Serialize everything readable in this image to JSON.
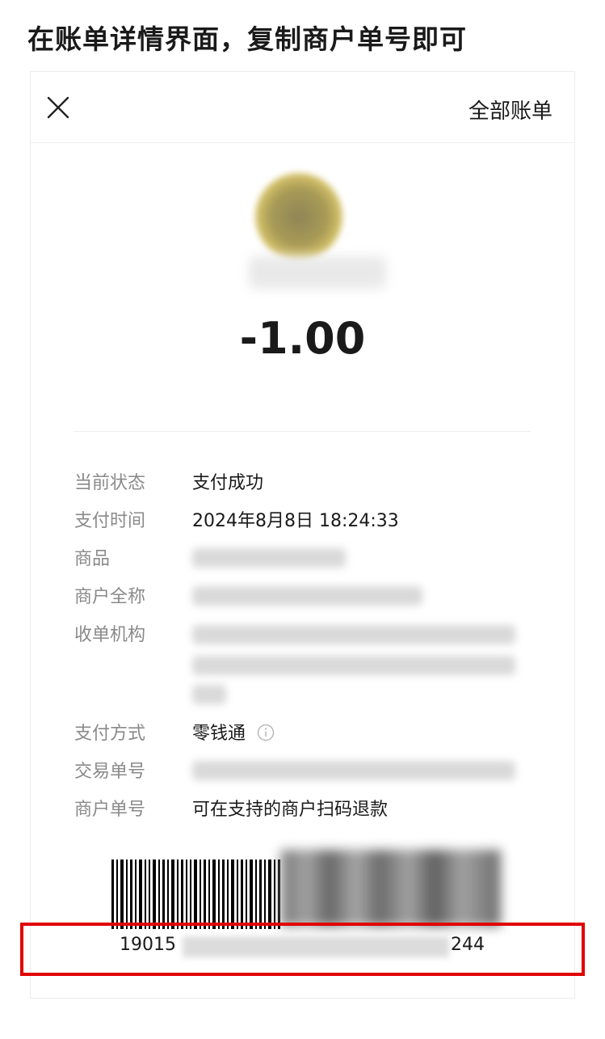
{
  "instruction": "在账单详情界面，复制商户单号即可",
  "header": {
    "all_bills_label": "全部账单"
  },
  "summary": {
    "amount": "-1.00"
  },
  "details": {
    "status": {
      "label": "当前状态",
      "value": "支付成功"
    },
    "pay_time": {
      "label": "支付时间",
      "value": "2024年8月8日 18:24:33"
    },
    "product": {
      "label": "商品"
    },
    "merchant_full_name": {
      "label": "商户全称"
    },
    "acquirer": {
      "label": "收单机构"
    },
    "pay_method": {
      "label": "支付方式",
      "value": "零钱通"
    },
    "transaction_no": {
      "label": "交易单号"
    },
    "merchant_order_no": {
      "label": "商户单号",
      "value": "可在支持的商户扫码退款"
    }
  },
  "barcode": {
    "number_prefix": "19015",
    "number_suffix": "244"
  },
  "colors": {
    "highlight": "#e00000",
    "label_gray": "#8a8a8a"
  },
  "icons": {
    "close": "close-icon",
    "info": "info-icon"
  }
}
